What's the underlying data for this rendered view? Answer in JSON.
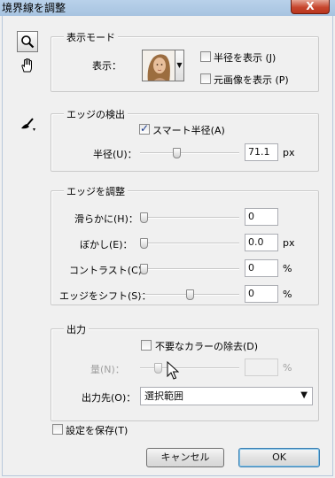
{
  "window": {
    "title": "境界線を調整",
    "close_label": "X"
  },
  "view_mode": {
    "legend": "表示モード",
    "view_label": "表示：",
    "show_radius_label": "半径を表示 (J)",
    "show_original_label": "元画像を表示 (P)",
    "show_radius_checked": false,
    "show_original_checked": false
  },
  "edge_detection": {
    "legend": "エッジの検出",
    "smart_radius_label": "スマート半径(A)",
    "smart_radius_checked": true,
    "radius_label": "半径(U)：",
    "radius_value": "71.1",
    "radius_unit": "px",
    "radius_level": 0.36
  },
  "adjust_edge": {
    "legend": "エッジを調整",
    "rows": [
      {
        "label": "滑らかに(H)：",
        "value": "0",
        "unit": "",
        "level": 0.0
      },
      {
        "label": "ぼかし(E)：",
        "value": "0.0",
        "unit": "px",
        "level": 0.0
      },
      {
        "label": "コントラスト(C)：",
        "value": "0",
        "unit": "%",
        "level": 0.0
      },
      {
        "label": "エッジをシフト(S)：",
        "value": "0",
        "unit": "%",
        "level": 0.5
      }
    ]
  },
  "output": {
    "legend": "出力",
    "decontaminate_label": "不要なカラーの除去(D)",
    "decontaminate_checked": false,
    "amount_label": "量(N)：",
    "amount_value": "",
    "amount_unit": "%",
    "amount_level": 0.15,
    "output_to_label": "出力先(O)：",
    "output_to_value": "選択範囲"
  },
  "remember_label": "設定を保存(T)",
  "remember_checked": false,
  "buttons": {
    "cancel": "キャンセル",
    "ok": "OK"
  },
  "tools": [
    "zoom-icon",
    "hand-icon",
    "refine-radius-brush-icon"
  ]
}
